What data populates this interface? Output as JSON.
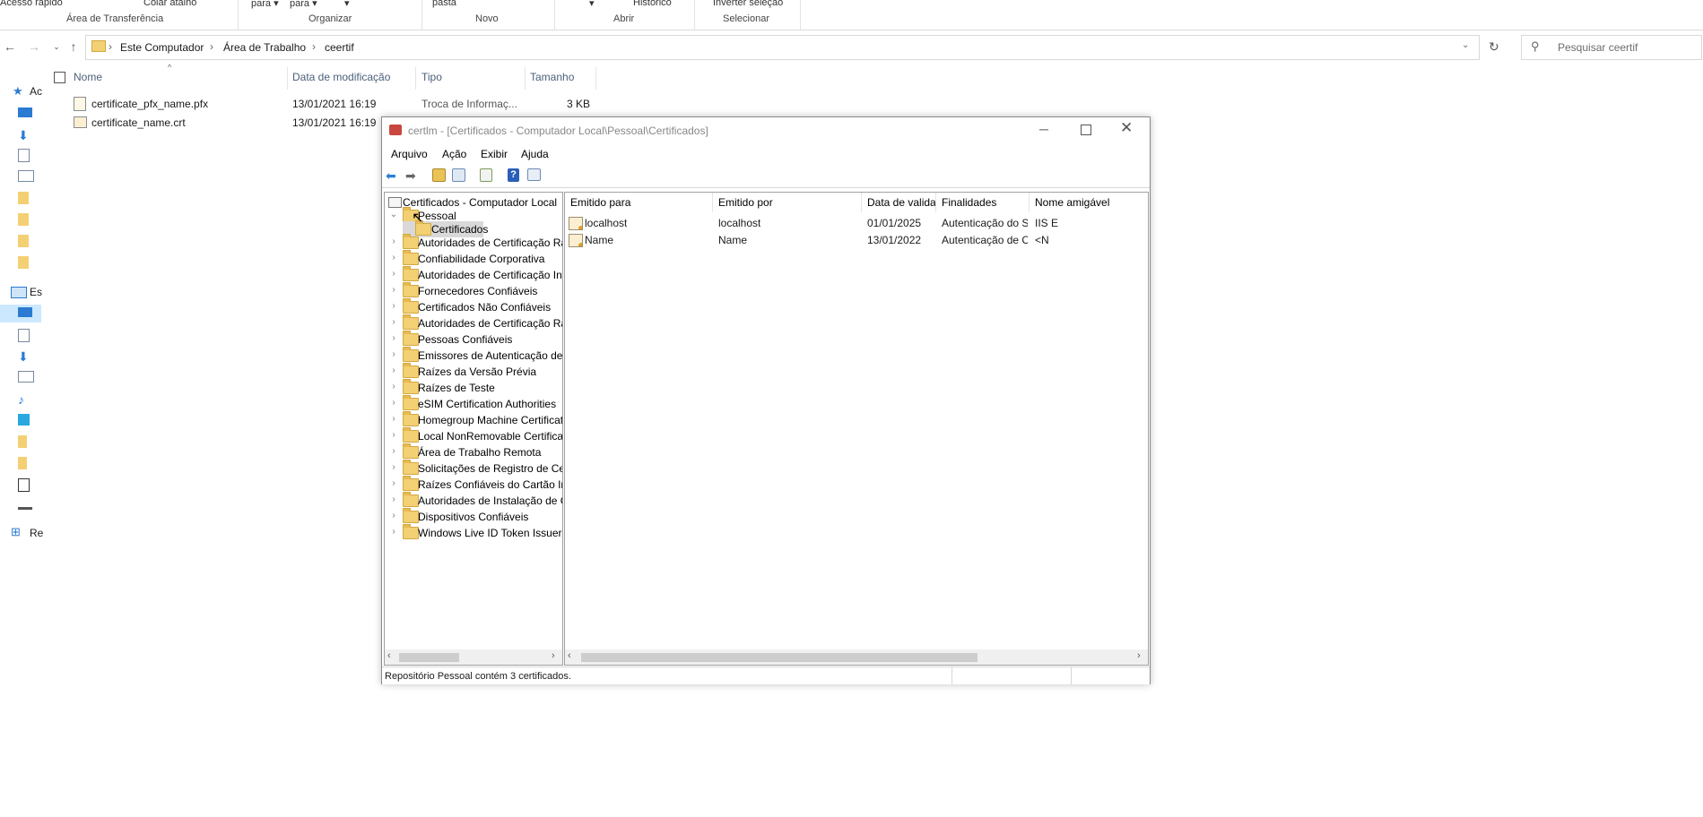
{
  "ribbon": {
    "top_partial": [
      "Acesso rápido",
      "Colar atalho",
      "para ▾",
      "para ▾",
      "▾",
      "pasta",
      "▾",
      "Histórico",
      "Inverter seleção"
    ],
    "groups": [
      "Área de Transferência",
      "Organizar",
      "Novo",
      "Abrir",
      "Selecionar"
    ]
  },
  "address": {
    "breadcrumbs": [
      "Este Computador",
      "Área de Trabalho",
      "ceertif"
    ],
    "search_placeholder": "Pesquisar ceertif"
  },
  "explorer": {
    "columns": [
      "Nome",
      "Data de modificação",
      "Tipo",
      "Tamanho"
    ],
    "files": [
      {
        "name": "certificate_pfx_name.pfx",
        "date": "13/01/2021 16:19",
        "type": "Troca de Informaç...",
        "size": "3 KB"
      },
      {
        "name": "certificate_name.crt",
        "date": "13/01/2021 16:19",
        "type": "",
        "size": ""
      }
    ],
    "nav_partial": [
      "Ac",
      "Es",
      "Re"
    ]
  },
  "mmc": {
    "title": "certlm - [Certificados - Computador Local\\Pessoal\\Certificados]",
    "menu": [
      "Arquivo",
      "Ação",
      "Exibir",
      "Ajuda"
    ],
    "tree": {
      "root": "Certificados - Computador Local",
      "pessoal": "Pessoal",
      "certificados": "Certificados",
      "stores": [
        "Autoridades de Certificação Raiz Confiáveis",
        "Confiabilidade Corporativa",
        "Autoridades de Certificação Intermediárias",
        "Fornecedores Confiáveis",
        "Certificados Não Confiáveis",
        "Autoridades de Certificação Raiz de Terceiros",
        "Pessoas Confiáveis",
        "Emissores de Autenticação de Cliente",
        "Raízes da Versão Prévia",
        "Raízes de Teste",
        "eSIM Certification Authorities",
        "Homegroup Machine Certificates",
        "Local NonRemovable Certificates",
        "Área de Trabalho Remota",
        "Solicitações de Registro de Certificado",
        "Raízes Confiáveis do Cartão Inteligente",
        "Autoridades de Instalação de Certificados",
        "Dispositivos Confiáveis",
        "Windows Live ID Token Issuer"
      ]
    },
    "list": {
      "columns": [
        "Emitido para",
        "Emitido por",
        "Data de validade",
        "Finalidades",
        "Nome amigável"
      ],
      "rows": [
        {
          "to": "localhost",
          "by": "localhost",
          "expires": "01/01/2025",
          "purpose": "Autenticação do Se...",
          "friendly": "IIS E"
        },
        {
          "to": "Name",
          "by": "Name",
          "expires": "13/01/2022",
          "purpose": "Autenticação de Cli...",
          "friendly": "<N"
        }
      ]
    },
    "status": "Repositório Pessoal contém 3 certificados."
  },
  "colors": {
    "folder": "#f4d074",
    "accent": "#0078d7",
    "selected": "#cce8ff"
  }
}
